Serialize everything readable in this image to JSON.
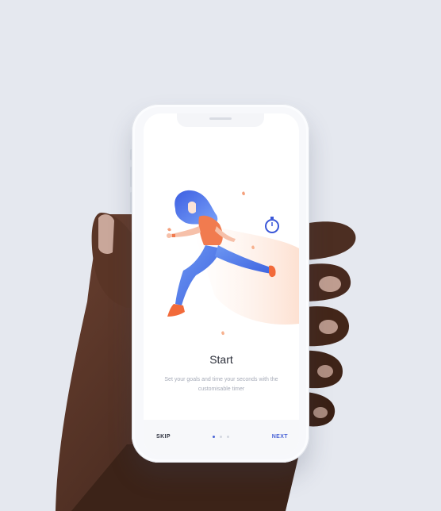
{
  "onboarding": {
    "title": "Start",
    "subtitle": "Set your goals and time your seconds with the customisable timer",
    "skip_label": "SKIP",
    "next_label": "NEXT",
    "page_total": 3,
    "active_page": 1
  },
  "colors": {
    "accent": "#4a64d6",
    "background": "#e5e8ef",
    "hair": "#4f6ee0",
    "shirt": "#f17b4f",
    "pants": "#5c8df0"
  },
  "icons": [
    "stopwatch-icon",
    "runner-illustration",
    "leaf-icon"
  ]
}
